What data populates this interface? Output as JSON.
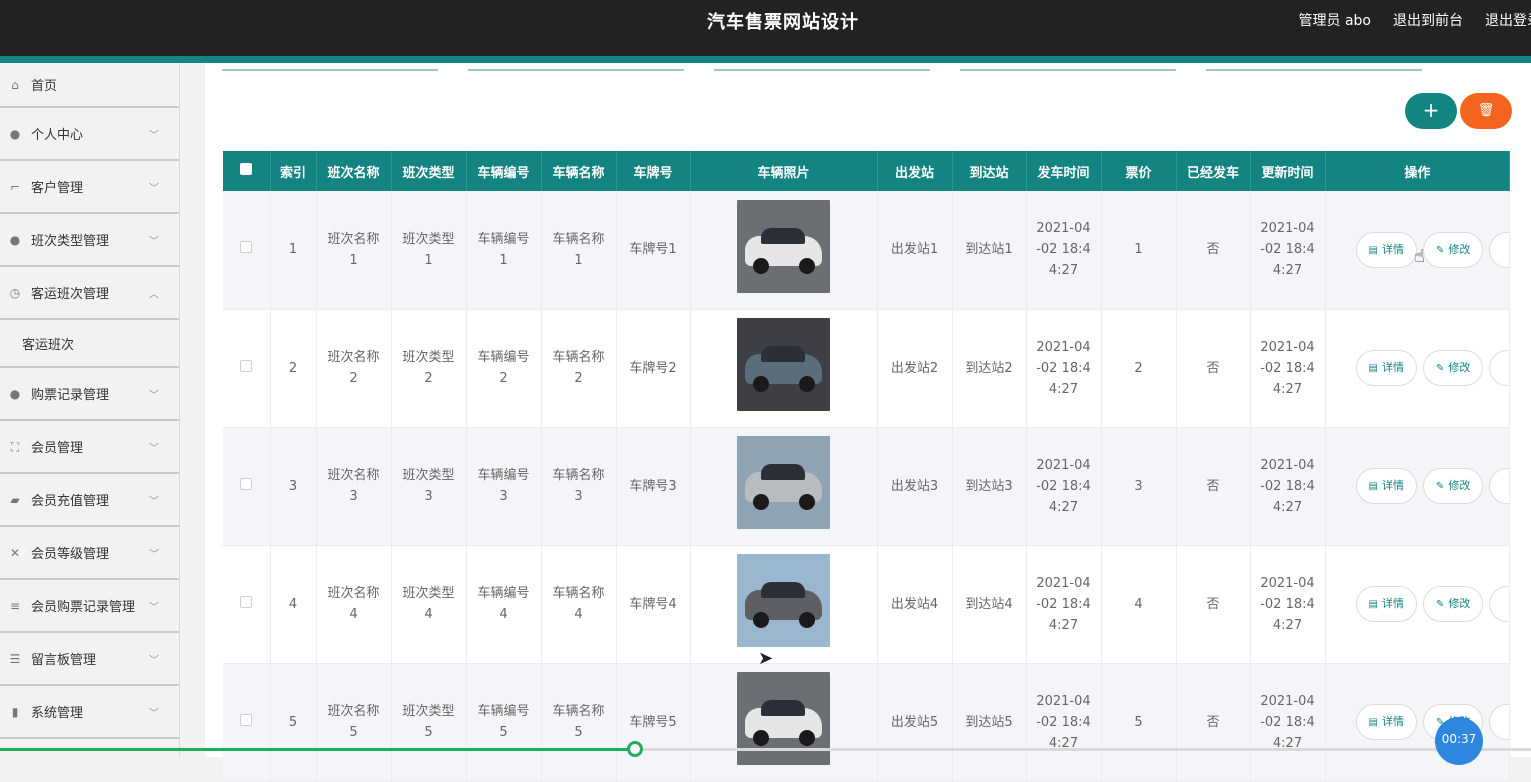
{
  "header": {
    "title": "汽车售票网站设计",
    "links": [
      "管理员 abo",
      "退出到前台",
      "退出登录"
    ]
  },
  "sidebar": {
    "items": [
      {
        "label": "首页",
        "icon": "home-icon",
        "glyph": "⌂",
        "chevron": ""
      },
      {
        "label": "个人中心",
        "icon": "user-icon",
        "glyph": "●",
        "chevron": "﹀"
      },
      {
        "label": "客户管理",
        "icon": "crop-icon",
        "glyph": "⌐",
        "chevron": "﹀"
      },
      {
        "label": "班次类型管理",
        "icon": "user-icon",
        "glyph": "●",
        "chevron": "﹀"
      },
      {
        "label": "客运班次管理",
        "icon": "compass-icon",
        "glyph": "◷",
        "chevron": "︿"
      },
      {
        "label": "购票记录管理",
        "icon": "location-icon",
        "glyph": "●",
        "chevron": "﹀"
      },
      {
        "label": "会员管理",
        "icon": "fullscreen-icon",
        "glyph": "⛶",
        "chevron": "﹀"
      },
      {
        "label": "会员充值管理",
        "icon": "ticket-icon",
        "glyph": "▰",
        "chevron": "﹀"
      },
      {
        "label": "会员等级管理",
        "icon": "bell-off-icon",
        "glyph": "✕",
        "chevron": "﹀"
      },
      {
        "label": "会员购票记录管理",
        "icon": "list-icon",
        "glyph": "≡",
        "chevron": "﹀"
      },
      {
        "label": "留言板管理",
        "icon": "sliders-icon",
        "glyph": "☰",
        "chevron": "﹀"
      },
      {
        "label": "系统管理",
        "icon": "chart-icon",
        "glyph": "▮",
        "chevron": "﹀"
      }
    ],
    "subitem": "客运班次"
  },
  "toolbar": {
    "add_label": "+",
    "delete_label": "🗑"
  },
  "table": {
    "columns": [
      "索引",
      "班次名称",
      "班次类型",
      "车辆编号",
      "车辆名称",
      "车牌号",
      "车辆照片",
      "出发站",
      "到达站",
      "发车时间",
      "票价",
      "已经发车",
      "更新时间",
      "操作"
    ],
    "rows": [
      {
        "index": "1",
        "name1": "班次名称",
        "name2": "1",
        "type1": "班次类型",
        "type2": "1",
        "code1": "车辆编号",
        "code2": "1",
        "car1": "车辆名称",
        "car2": "1",
        "plate": "车牌号1",
        "from": "出发站1",
        "to": "到达站1",
        "t1": "2021-04",
        "t2": "-02 18:4",
        "t3": "4:27",
        "price": "1",
        "departed": "否",
        "u1": "2021-04",
        "u2": "-02 18:4",
        "u3": "4:27",
        "photo_color": "#6b6f74",
        "car_color": "#e6e6e6"
      },
      {
        "index": "2",
        "name1": "班次名称",
        "name2": "2",
        "type1": "班次类型",
        "type2": "2",
        "code1": "车辆编号",
        "code2": "2",
        "car1": "车辆名称",
        "car2": "2",
        "plate": "车牌号2",
        "from": "出发站2",
        "to": "到达站2",
        "t1": "2021-04",
        "t2": "-02 18:4",
        "t3": "4:27",
        "price": "2",
        "departed": "否",
        "u1": "2021-04",
        "u2": "-02 18:4",
        "u3": "4:27",
        "photo_color": "#3d3f44",
        "car_color": "#5a6d7a"
      },
      {
        "index": "3",
        "name1": "班次名称",
        "name2": "3",
        "type1": "班次类型",
        "type2": "3",
        "code1": "车辆编号",
        "code2": "3",
        "car1": "车辆名称",
        "car2": "3",
        "plate": "车牌号3",
        "from": "出发站3",
        "to": "到达站3",
        "t1": "2021-04",
        "t2": "-02 18:4",
        "t3": "4:27",
        "price": "3",
        "departed": "否",
        "u1": "2021-04",
        "u2": "-02 18:4",
        "u3": "4:27",
        "photo_color": "#8fa3b3",
        "car_color": "#b8bcc0"
      },
      {
        "index": "4",
        "name1": "班次名称",
        "name2": "4",
        "type1": "班次类型",
        "type2": "4",
        "code1": "车辆编号",
        "code2": "4",
        "car1": "车辆名称",
        "car2": "4",
        "plate": "车牌号4",
        "from": "出发站4",
        "to": "到达站4",
        "t1": "2021-04",
        "t2": "-02 18:4",
        "t3": "4:27",
        "price": "4",
        "departed": "否",
        "u1": "2021-04",
        "u2": "-02 18:4",
        "u3": "4:27",
        "photo_color": "#9bb6cf",
        "car_color": "#5e5f63"
      },
      {
        "index": "5",
        "name1": "班次名称",
        "name2": "5",
        "type1": "班次类型",
        "type2": "5",
        "code1": "车辆编号",
        "code2": "5",
        "car1": "车辆名称",
        "car2": "5",
        "plate": "车牌号5",
        "from": "出发站5",
        "to": "到达站5",
        "t1": "2021-04",
        "t2": "-02 18:4",
        "t3": "4:27",
        "price": "5",
        "departed": "否",
        "u1": "2021-04",
        "u2": "-02 18:4",
        "u3": "4:27",
        "photo_color": "#6b6f74",
        "car_color": "#e6e6e6"
      }
    ],
    "actions": {
      "detail": "详情",
      "edit": "修改"
    }
  },
  "player": {
    "time": "00:37",
    "progress": 0.415
  },
  "colors": {
    "accent": "#138481",
    "danger": "#f5641e",
    "progress": "#1fae5f"
  }
}
